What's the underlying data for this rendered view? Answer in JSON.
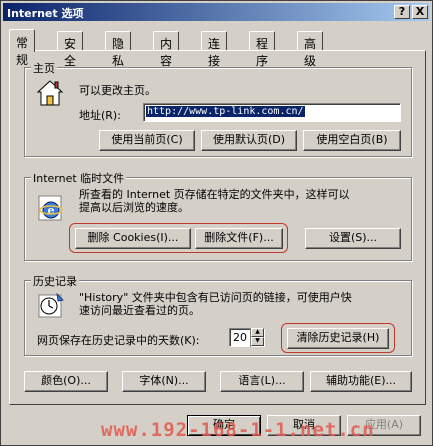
{
  "window": {
    "title": "Internet 选项",
    "help_label": "?",
    "close_label": "X"
  },
  "tabs": [
    {
      "label": "常规"
    },
    {
      "label": "安全"
    },
    {
      "label": "隐私"
    },
    {
      "label": "内容"
    },
    {
      "label": "连接"
    },
    {
      "label": "程序"
    },
    {
      "label": "高级"
    }
  ],
  "homepage": {
    "group_title": "主页",
    "description": "可以更改主页。",
    "address_label": "地址(R):",
    "address_value": "http://www.tp-link.com.cn/",
    "use_current": "使用当前页(C)",
    "use_default": "使用默认页(D)",
    "use_blank": "使用空白页(B)"
  },
  "temp_files": {
    "group_title": "Internet 临时文件",
    "description_line1": "所查看的 Internet 页存储在特定的文件夹中，这样可以",
    "description_line2": "提高以后浏览的速度。",
    "delete_cookies": "删除 Cookies(I)...",
    "delete_files": "删除文件(F)...",
    "settings": "设置(S)..."
  },
  "history": {
    "group_title": "历史记录",
    "description_line1": "\"History\" 文件夹中包含有已访问页的链接，可使用户快",
    "description_line2": "速访问最近查看过的页。",
    "days_label": "网页保存在历史记录中的天数(K):",
    "days_value": "20",
    "clear_history": "清除历史记录(H)"
  },
  "bottom_buttons": {
    "colors": "颜色(O)...",
    "fonts": "字体(N)...",
    "languages": "语言(L)...",
    "accessibility": "辅助功能(E)..."
  },
  "dialog_buttons": {
    "ok": "确定",
    "cancel": "取消",
    "apply": "应用(A)"
  },
  "watermark": "www.192-168-1-1.net.cn",
  "colors": {
    "highlight": "#c0392b",
    "title_bar": "#0a246a"
  }
}
